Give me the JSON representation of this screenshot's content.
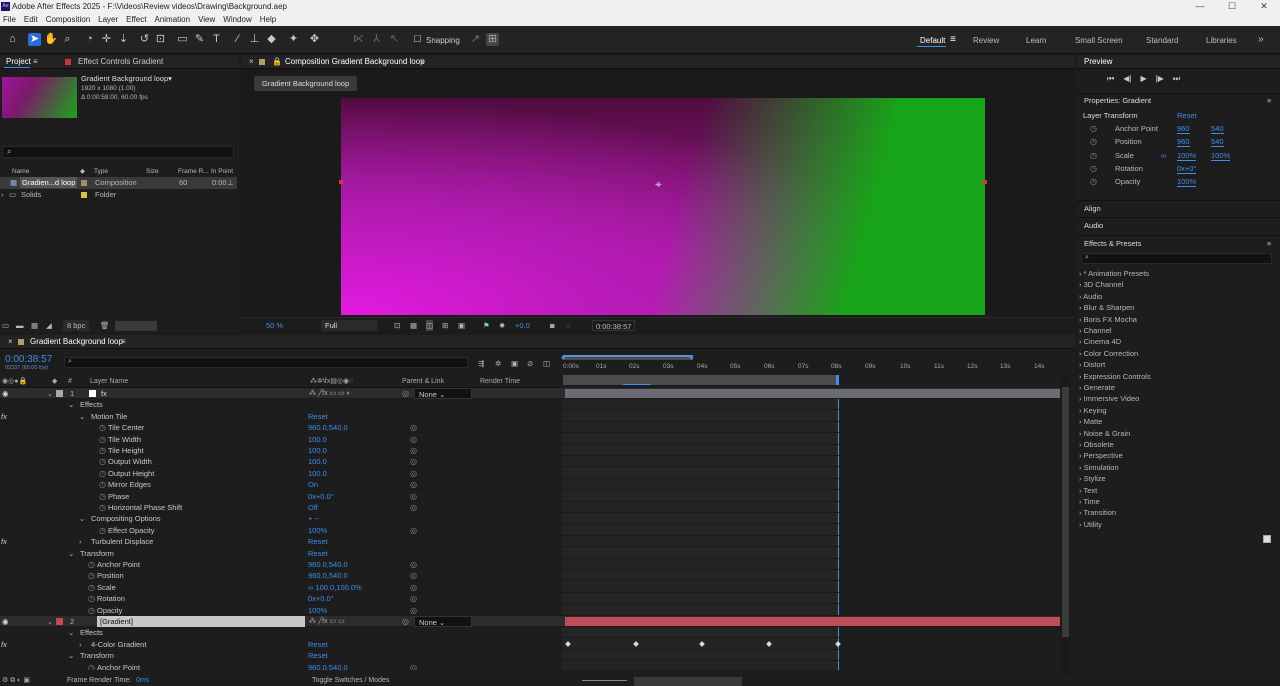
{
  "app": {
    "title": "Adobe After Effects 2025 - F:\\Videos\\Review videos\\Drawing\\Background.aep",
    "window_controls": [
      "—",
      "☐",
      "✕"
    ]
  },
  "menu": [
    "File",
    "Edit",
    "Composition",
    "Layer",
    "Effect",
    "Animation",
    "View",
    "Window",
    "Help"
  ],
  "toolbar": {
    "snapping": "Snapping",
    "workspaces": [
      "Default",
      "Review",
      "Learn",
      "Small Screen",
      "Standard",
      "Libraries"
    ],
    "overflow": "»"
  },
  "project": {
    "tab": "Project",
    "effect_tab": "Effect Controls Gradient",
    "comp_name": "Gradient Background loop▾",
    "comp_dims": "1920 x 1080 (1.00)",
    "comp_dur": "Δ 0:00:58:00, 60.00 fps",
    "columns": {
      "name": "Name",
      "type": "Type",
      "size": "Size",
      "frame": "Frame R...",
      "inpoint": "In Point"
    },
    "items": [
      {
        "name": "Gradien...d loop",
        "type": "Composition",
        "frame": "60",
        "inpoint": "0:00"
      },
      {
        "name": "Solids",
        "type": "Folder",
        "frame": "",
        "inpoint": ""
      }
    ],
    "bpc": "8 bpc"
  },
  "comp": {
    "tab": "Composition Gradient Background loop",
    "button": "Gradient Background loop",
    "zoom": "50 %",
    "resolution": "Full",
    "exposure": "+0.0",
    "timecode": "0:00:38:57"
  },
  "colors": {
    "grad_magenta": "#d614d6",
    "grad_dark": "#5a0a3a",
    "grad_green": "#18a418",
    "accent": "#3d8ee8",
    "layer_bar": "#c04c5a"
  },
  "preview": {
    "title": "Preview"
  },
  "properties": {
    "title": "Properties: Gradient",
    "section": "Layer Transform",
    "reset": "Reset",
    "rows": [
      {
        "label": "Anchor Point",
        "v1": "960",
        "v2": "540"
      },
      {
        "label": "Position",
        "v1": "960",
        "v2": "540"
      },
      {
        "label": "Scale",
        "v1": "100%",
        "v2": "100%"
      },
      {
        "label": "Rotation",
        "v1": "0x+0°",
        "v2": ""
      },
      {
        "label": "Opacity",
        "v1": "100%",
        "v2": ""
      }
    ]
  },
  "align": "Align",
  "audio": "Audio",
  "effects_presets": {
    "title": "Effects & Presets",
    "items": [
      "* Animation Presets",
      "3D Channel",
      "Audio",
      "Blur & Sharpen",
      "Boris FX Mocha",
      "Channel",
      "Cinema 4D",
      "Color Correction",
      "Distort",
      "Expression Controls",
      "Generate",
      "Immersive Video",
      "Keying",
      "Matte",
      "Noise & Grain",
      "Obsolete",
      "Perspective",
      "Simulation",
      "Stylize",
      "Text",
      "Time",
      "Transition",
      "Utility"
    ]
  },
  "timeline": {
    "tab": "Gradient Background loop",
    "timecode": "0:00:38:57",
    "frames": "02337 (60.00 fps)",
    "headers": {
      "num": "#",
      "layer_name": "Layer Name",
      "parent": "Parent & Link",
      "render": "Render Time"
    },
    "ruler": [
      "0:00s",
      "01s",
      "02s",
      "03s",
      "04s",
      "05s",
      "06s",
      "07s",
      "08s",
      "09s",
      "10s",
      "11s",
      "12s",
      "13s",
      "14s"
    ],
    "rows": [
      {
        "kind": "layer",
        "indent": 0,
        "label": "1",
        "name": "fx",
        "value": "",
        "parent": "None"
      },
      {
        "kind": "prop",
        "indent": 1,
        "label": "Effects",
        "value": ""
      },
      {
        "kind": "prop",
        "indent": 2,
        "label": "Motion Tile",
        "value": "Reset"
      },
      {
        "kind": "prop",
        "indent": 3,
        "label": "Tile Center",
        "value": "960.0,540.0"
      },
      {
        "kind": "prop",
        "indent": 3,
        "label": "Tile Width",
        "value": "100.0"
      },
      {
        "kind": "prop",
        "indent": 3,
        "label": "Tile Height",
        "value": "100.0"
      },
      {
        "kind": "prop",
        "indent": 3,
        "label": "Output Width",
        "value": "100.0"
      },
      {
        "kind": "prop",
        "indent": 3,
        "label": "Output Height",
        "value": "100.0"
      },
      {
        "kind": "prop",
        "indent": 3,
        "label": "Mirror Edges",
        "value": "On"
      },
      {
        "kind": "prop",
        "indent": 3,
        "label": "Phase",
        "value": "0x+0.0°"
      },
      {
        "kind": "prop",
        "indent": 3,
        "label": "Horizontal Phase Shift",
        "value": "Off"
      },
      {
        "kind": "prop",
        "indent": 2,
        "label": "Compositing Options",
        "value": "+ −"
      },
      {
        "kind": "prop",
        "indent": 3,
        "label": "Effect Opacity",
        "value": "100%"
      },
      {
        "kind": "prop",
        "indent": 2,
        "label": "Turbulent Displace",
        "value": "Reset"
      },
      {
        "kind": "prop",
        "indent": 1,
        "label": "Transform",
        "value": "Reset"
      },
      {
        "kind": "prop",
        "indent": 2,
        "label": "Anchor Point",
        "value": "960.0,540.0"
      },
      {
        "kind": "prop",
        "indent": 2,
        "label": "Position",
        "value": "960.0,540.0"
      },
      {
        "kind": "prop",
        "indent": 2,
        "label": "Scale",
        "value": "∞ 100.0,100.0%"
      },
      {
        "kind": "prop",
        "indent": 2,
        "label": "Rotation",
        "value": "0x+0.0°"
      },
      {
        "kind": "prop",
        "indent": 2,
        "label": "Opacity",
        "value": "100%"
      },
      {
        "kind": "layer",
        "indent": 0,
        "label": "2",
        "name": "[Gradient]",
        "value": "",
        "parent": "None"
      },
      {
        "kind": "prop",
        "indent": 1,
        "label": "Effects",
        "value": ""
      },
      {
        "kind": "prop",
        "indent": 2,
        "label": "4-Color Gradient",
        "value": "Reset"
      },
      {
        "kind": "prop",
        "indent": 1,
        "label": "Transform",
        "value": "Reset"
      },
      {
        "kind": "prop",
        "indent": 2,
        "label": "Anchor Point",
        "value": "960.0,540.0"
      }
    ],
    "footer": {
      "render_label": "Frame Render Time:",
      "render_value": "0ms",
      "toggle": "Toggle Switches / Modes"
    }
  }
}
